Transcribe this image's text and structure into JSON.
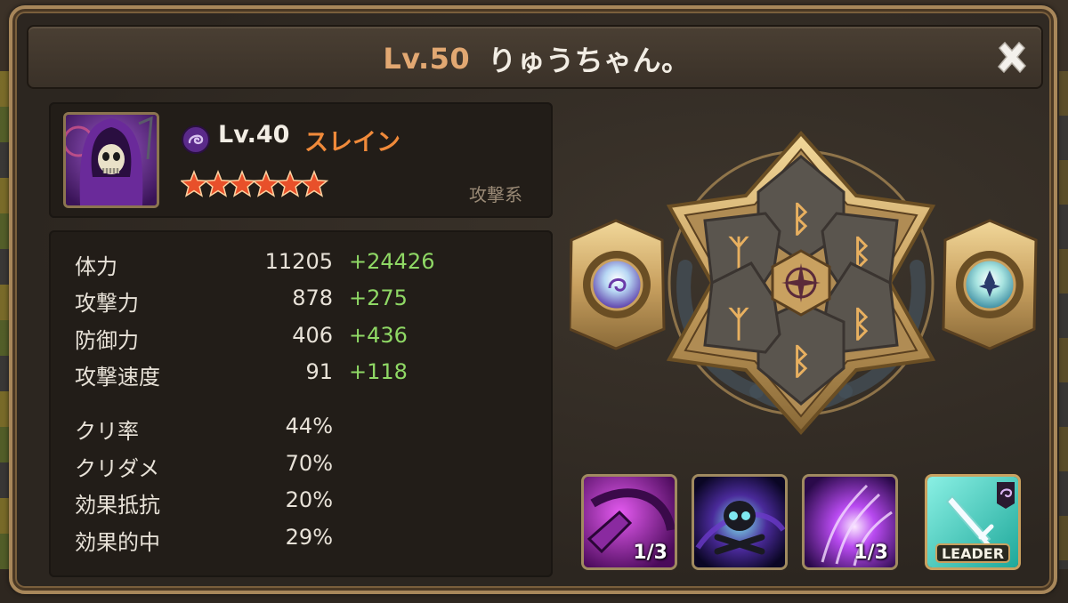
{
  "window": {
    "level": "Lv.50",
    "title": "りゅうちゃん。"
  },
  "monster": {
    "level": "Lv.40",
    "name": "スレイン",
    "type": "攻撃系",
    "stars": 6,
    "element_icon": "dark-element-icon",
    "portrait_icon": "hooded-skeleton-reaper-portrait"
  },
  "stats": {
    "base": [
      {
        "label": "体力",
        "value": "11205",
        "bonus": "+24426"
      },
      {
        "label": "攻撃力",
        "value": "878",
        "bonus": "+275"
      },
      {
        "label": "防御力",
        "value": "406",
        "bonus": "+436"
      },
      {
        "label": "攻撃速度",
        "value": "91",
        "bonus": "+118"
      }
    ],
    "extra": [
      {
        "label": "クリ率",
        "value": "44%"
      },
      {
        "label": "クリダメ",
        "value": "70%"
      },
      {
        "label": "効果抵抗",
        "value": "20%"
      },
      {
        "label": "効果的中",
        "value": "29%"
      }
    ]
  },
  "runes": {
    "slots": [
      {
        "slot": 1,
        "glyph": "ᛒ"
      },
      {
        "slot": 2,
        "glyph": "ᛒ"
      },
      {
        "slot": 3,
        "glyph": "ᛒ"
      },
      {
        "slot": 4,
        "glyph": "ᛒ"
      },
      {
        "slot": 5,
        "glyph": "ᛉ"
      },
      {
        "slot": 6,
        "glyph": "ᛉ"
      }
    ],
    "center_icon": "compass-emblem-icon"
  },
  "artifacts": {
    "left_icon": "dark-attribute-artifact-icon",
    "right_icon": "fleur-de-lis-artifact-icon"
  },
  "skills": [
    {
      "icon": "purple-scythe-slash-icon",
      "level": "1/3"
    },
    {
      "icon": "skull-crossbones-vortex-icon",
      "level": ""
    },
    {
      "icon": "purple-claw-burst-icon",
      "level": "1/3"
    },
    {
      "icon": "leader-sword-icon",
      "label": "LEADER"
    }
  ],
  "colors": {
    "accent": "#e2a872",
    "name": "#f08a3a",
    "bonus": "#8fd865",
    "gold": "#c9a160"
  }
}
